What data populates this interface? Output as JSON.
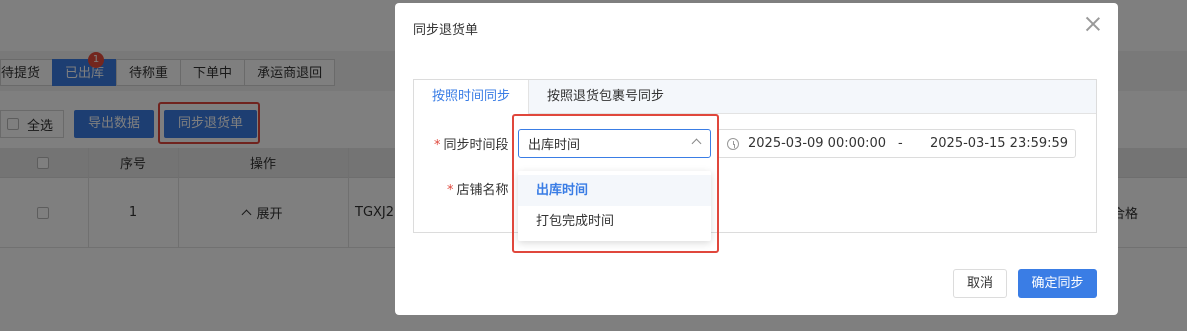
{
  "background": {
    "status_tabs": [
      {
        "label": "待提货",
        "active": false
      },
      {
        "label": "已出库",
        "active": true,
        "badge": "1"
      },
      {
        "label": "待称重",
        "active": false
      },
      {
        "label": "下单中",
        "active": false
      },
      {
        "label": "承运商退回",
        "active": false
      }
    ],
    "toolbar": {
      "select_all_label": "全选",
      "export_label": "导出数据",
      "sync_return_label": "同步退货单"
    },
    "table": {
      "headers": {
        "index": "序号",
        "operation": "操作"
      },
      "row": {
        "index": "1",
        "expand": "展开",
        "order_prefix": "TGXJ2",
        "status_tail": "合格"
      }
    }
  },
  "modal": {
    "title": "同步退货单",
    "tabs": [
      {
        "label": "按照时间同步",
        "active": true
      },
      {
        "label": "按照退货包裹号同步",
        "active": false
      }
    ],
    "form": {
      "period_label": "同步时间段",
      "shop_label": "店铺名称",
      "period_select_value": "出库时间",
      "date_start": "2025-03-09 00:00:00",
      "date_separator": "-",
      "date_end": "2025-03-15 23:59:59",
      "dropdown_options": [
        "出库时间",
        "打包完成时间"
      ]
    },
    "buttons": {
      "cancel": "取消",
      "confirm": "确定同步"
    }
  },
  "colors": {
    "accent": "#3a7de5",
    "highlight": "#e0473c"
  }
}
